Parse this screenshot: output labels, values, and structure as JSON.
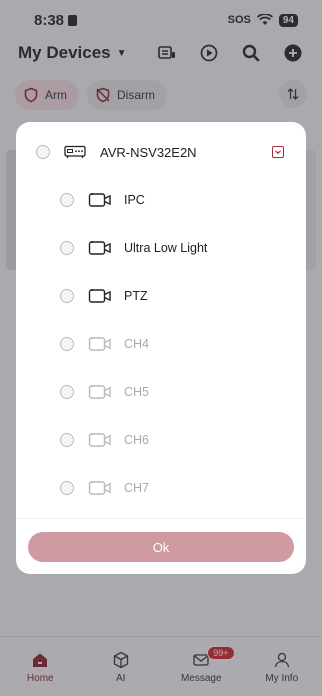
{
  "status_bar": {
    "time": "8:38",
    "sos": "SOS",
    "battery": "94"
  },
  "header": {
    "title": "My Devices"
  },
  "filters": {
    "arm_label": "Arm",
    "disarm_label": "Disarm"
  },
  "modal": {
    "device": {
      "name": "AVR-NSV32E2N",
      "icon": "nvr-icon"
    },
    "channels": [
      {
        "name": "IPC",
        "enabled": true
      },
      {
        "name": "Ultra Low Light",
        "enabled": true
      },
      {
        "name": "PTZ",
        "enabled": true
      },
      {
        "name": "CH4",
        "enabled": false
      },
      {
        "name": "CH5",
        "enabled": false
      },
      {
        "name": "CH6",
        "enabled": false
      },
      {
        "name": "CH7",
        "enabled": false
      }
    ],
    "ok_label": "Ok"
  },
  "tabbar": {
    "items": [
      {
        "label": "Home",
        "icon": "home-icon",
        "active": true
      },
      {
        "label": "AI",
        "icon": "cube-icon",
        "active": false
      },
      {
        "label": "Message",
        "icon": "mail-icon",
        "active": false
      },
      {
        "label": "My Info",
        "icon": "person-icon",
        "active": false
      }
    ],
    "message_badge": "99+"
  },
  "colors": {
    "accent": "#8a1f2c",
    "ok_button": "#cf9aa1",
    "badge": "#d61f2c"
  }
}
